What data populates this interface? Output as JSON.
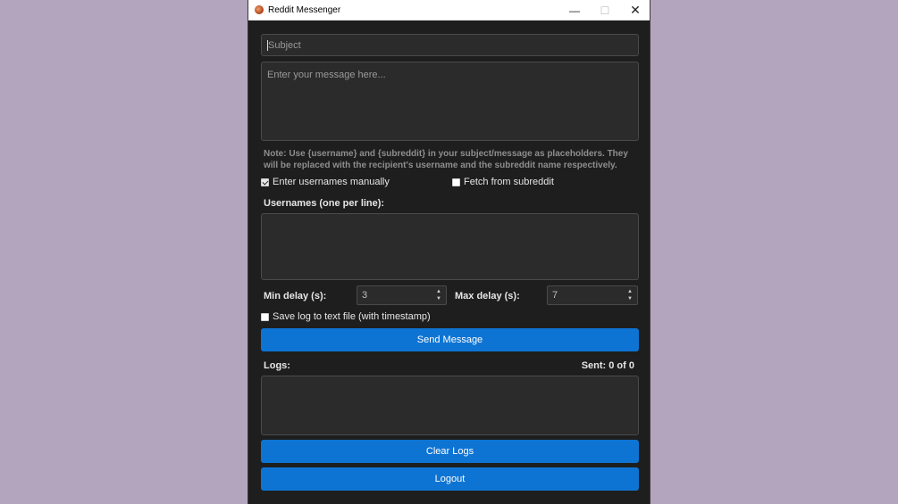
{
  "window": {
    "title": "Reddit Messenger",
    "minimize_glyph": "—",
    "maximize_glyph": "☐",
    "close_glyph": "✕"
  },
  "form": {
    "subject_placeholder": "Subject",
    "message_placeholder": "Enter your message here...",
    "note": "Note: Use {username} and {subreddit} in your subject/message as placeholders. They will be replaced with the recipient's username and the subreddit name respectively.",
    "enter_manually_label": "Enter usernames manually",
    "enter_manually_checked": true,
    "fetch_subreddit_label": "Fetch from subreddit",
    "fetch_subreddit_checked": false,
    "usernames_label": "Usernames (one per line):",
    "usernames_value": "",
    "min_delay_label": "Min delay (s):",
    "min_delay_value": "3",
    "max_delay_label": "Max delay (s):",
    "max_delay_value": "7",
    "save_log_label": "Save log to text file (with timestamp)",
    "save_log_checked": false,
    "send_button": "Send Message",
    "logs_label": "Logs:",
    "sent_counter": "Sent: 0 of 0",
    "logs_value": "",
    "clear_logs_button": "Clear Logs",
    "logout_button": "Logout"
  },
  "colors": {
    "desktop": "#b3a5bd",
    "window_bg": "#1e1e1e",
    "accent": "#0e74d3"
  }
}
